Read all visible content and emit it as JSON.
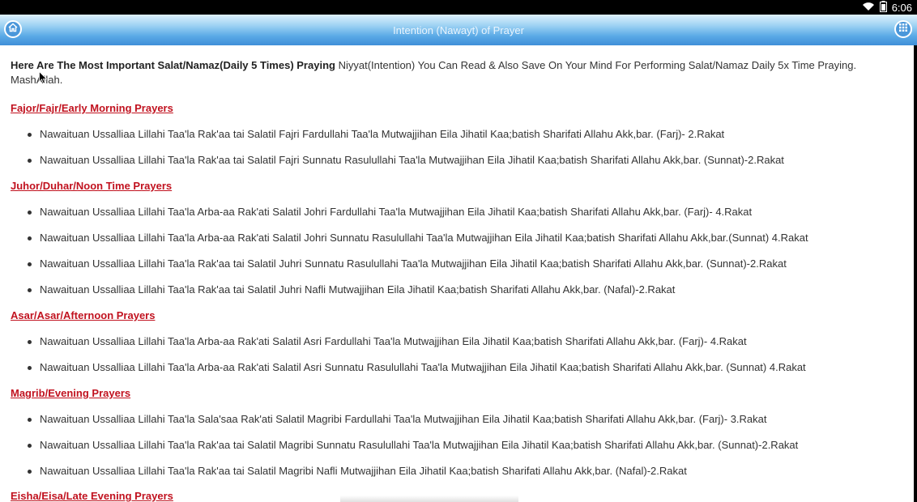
{
  "status_bar": {
    "time": "6:06",
    "icons": [
      "wifi-icon",
      "battery-icon"
    ]
  },
  "action_bar": {
    "title": "Intention (Nawayt) of Prayer",
    "home_icon": "home-icon",
    "grid_icon": "grid-icon"
  },
  "intro": {
    "bold_text": "Here Are The Most Important Salat/Namaz(Daily 5 Times) Praying",
    "rest_text": "Niyyat(Intention) You Can Read & Also Save On Your Mind For Performing Salat/Namaz Daily 5x Time Praying. MashAllah."
  },
  "sections": [
    {
      "heading": "Fajor/Fajr/Early Morning Prayers",
      "items": [
        "Nawaituan Ussalliaa Lillahi Taa'la Rak'aa tai Salatil Fajri Fardullahi Taa'la Mutwajjihan Eila Jihatil Kaa;batish Sharifati Allahu Akk,bar. (Farj)- 2.Rakat",
        "Nawaituan Ussalliaa Lillahi Taa'la Rak'aa tai Salatil Fajri Sunnatu Rasulullahi Taa'la Mutwajjihan Eila Jihatil Kaa;batish Sharifati Allahu Akk,bar. (Sunnat)-2.Rakat"
      ]
    },
    {
      "heading": "Juhor/Duhar/Noon Time Prayers",
      "items": [
        "Nawaituan Ussalliaa Lillahi Taa'la Arba-aa Rak'ati Salatil Johri Fardullahi Taa'la Mutwajjihan Eila Jihatil Kaa;batish Sharifati Allahu Akk,bar. (Farj)- 4.Rakat",
        "Nawaituan Ussalliaa Lillahi Taa'la Arba-aa Rak'ati Salatil Johri Sunnatu Rasulullahi Taa'la Mutwajjihan Eila Jihatil Kaa;batish Sharifati Allahu Akk,bar.(Sunnat) 4.Rakat",
        "Nawaituan Ussalliaa Lillahi Taa'la Rak'aa tai Salatil Juhri Sunnatu Rasulullahi Taa'la Mutwajjihan Eila Jihatil Kaa;batish Sharifati Allahu Akk,bar. (Sunnat)-2.Rakat",
        "Nawaituan Ussalliaa Lillahi Taa'la Rak'aa tai Salatil Juhri Nafli Mutwajjihan Eila Jihatil Kaa;batish Sharifati Allahu Akk,bar. (Nafal)-2.Rakat"
      ]
    },
    {
      "heading": "Asar/Asar/Afternoon Prayers",
      "items": [
        "Nawaituan Ussalliaa Lillahi Taa'la Arba-aa Rak'ati Salatil Asri Fardullahi Taa'la Mutwajjihan Eila Jihatil Kaa;batish Sharifati Allahu Akk,bar. (Farj)- 4.Rakat",
        "Nawaituan Ussalliaa Lillahi Taa'la Arba-aa Rak'ati Salatil Asri Sunnatu Rasulullahi Taa'la Mutwajjihan Eila Jihatil Kaa;batish Sharifati Allahu Akk,bar. (Sunnat) 4.Rakat"
      ]
    },
    {
      "heading": "Magrib/Evening Prayers",
      "items": [
        "Nawaituan Ussalliaa Lillahi Taa'la Sala'saa Rak'ati Salatil Magribi Fardullahi Taa'la Mutwajjihan Eila Jihatil Kaa;batish Sharifati Allahu Akk,bar. (Farj)- 3.Rakat",
        "Nawaituan Ussalliaa Lillahi Taa'la Rak'aa tai Salatil Magribi Sunnatu Rasulullahi Taa'la Mutwajjihan Eila Jihatil Kaa;batish Sharifati Allahu Akk,bar. (Sunnat)-2.Rakat",
        "Nawaituan Ussalliaa Lillahi Taa'la Rak'aa tai Salatil Magribi Nafli Mutwajjihan Eila Jihatil Kaa;batish Sharifati Allahu Akk,bar. (Nafal)-2.Rakat"
      ]
    },
    {
      "heading": "Eisha/Eisa/Late Evening Prayers",
      "items": []
    }
  ],
  "colors": {
    "heading": "#c1121f",
    "text": "#333333",
    "action_bar": "#4a97da"
  }
}
